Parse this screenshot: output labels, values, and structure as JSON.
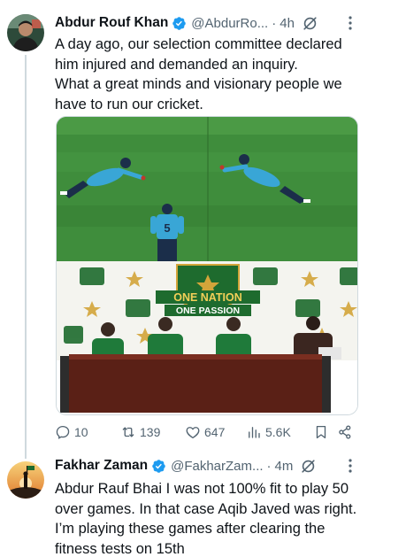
{
  "tweets": [
    {
      "author_name": "Abdur Rouf Khan",
      "handle": "@AbdurRo...",
      "separator": "·",
      "time": "4h",
      "lines": [
        "A day ago, our selection committee declared",
        "him injured and demanded an inquiry.",
        "What a great minds and visionary people we",
        "have to run our cricket."
      ],
      "media": {
        "banner_lines": [
          "ONE NATION",
          "ONE PASSION"
        ],
        "shirt_number": "5"
      },
      "stats": {
        "replies": "10",
        "retweets": "139",
        "likes": "647",
        "views": "5.6K"
      }
    },
    {
      "author_name": "Fakhar Zaman",
      "handle": "@FakharZam...",
      "separator": "·",
      "time": "4m",
      "lines": [
        "Abdur Rauf Bhai I was not 100% fit to play 50",
        "over games. In that case Aqib Javed was right.",
        "I’m playing these games after clearing the",
        "fitness tests on 15th"
      ]
    }
  ],
  "colors": {
    "verified": "#1d9bf0",
    "text": "#0f1419",
    "secondary": "#536471",
    "thread_line": "#cfd9de",
    "pitch": "#3f8d3c",
    "jersey": "#39a6d6",
    "table": "#5a2016",
    "backdrop_logo": "#1e6b2e",
    "backdrop_gold": "#d3a53a"
  },
  "icons": {
    "verified": "verified-badge-icon",
    "grok": "grok-icon",
    "more": "more-dots-icon",
    "reply": "reply-icon",
    "retweet": "retweet-icon",
    "like": "heart-icon",
    "views": "views-icon",
    "bookmark": "bookmark-icon",
    "share": "share-icon"
  }
}
